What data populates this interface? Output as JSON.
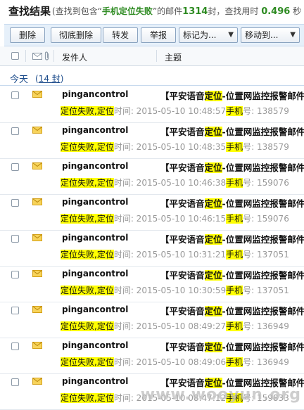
{
  "header": {
    "title": "查找结果",
    "desc_pre": "(查找到包含“",
    "keyword": "手机定位失败",
    "desc_mid": "”的邮件",
    "count": "1314",
    "desc_mid2": "封，查找用时",
    "time": "0.496",
    "desc_post": "秒"
  },
  "toolbar": {
    "delete": "删除",
    "delete_perm": "彻底删除",
    "forward": "转发",
    "report": "举报",
    "mark_as": "标记为...",
    "move_to": "移动到..."
  },
  "columns": {
    "sender": "发件人",
    "subject": "主题"
  },
  "group": {
    "label": "今天",
    "count_pre": "(",
    "count": "14 封",
    "count_post": ")"
  },
  "mails": [
    {
      "sender": "pingancontrol",
      "subj_a": "【平安语音",
      "subj_hl": "定位",
      "subj_b": "-位置网监控报警邮件",
      "pv_hl": "定位失败,定位",
      "pv_time": "时间: 2015-05-10 10:48:57",
      "pv_hl2": "手机",
      "pv_tail": "号: 138579"
    },
    {
      "sender": "pingancontrol",
      "subj_a": "【平安语音",
      "subj_hl": "定位",
      "subj_b": "-位置网监控报警邮件",
      "pv_hl": "定位失败,定位",
      "pv_time": "时间: 2015-05-10 10:48:35",
      "pv_hl2": "手机",
      "pv_tail": "号: 138579"
    },
    {
      "sender": "pingancontrol",
      "subj_a": "【平安语音",
      "subj_hl": "定位",
      "subj_b": "-位置网监控报警邮件",
      "pv_hl": "定位失败,定位",
      "pv_time": "时间: 2015-05-10 10:46:38",
      "pv_hl2": "手机",
      "pv_tail": "号: 159076"
    },
    {
      "sender": "pingancontrol",
      "subj_a": "【平安语音",
      "subj_hl": "定位",
      "subj_b": "-位置网监控报警邮件",
      "pv_hl": "定位失败,定位",
      "pv_time": "时间: 2015-05-10 10:46:15",
      "pv_hl2": "手机",
      "pv_tail": "号: 159076"
    },
    {
      "sender": "pingancontrol",
      "subj_a": "【平安语音",
      "subj_hl": "定位",
      "subj_b": "-位置网监控报警邮件",
      "pv_hl": "定位失败,定位",
      "pv_time": "时间: 2015-05-10 10:31:21",
      "pv_hl2": "手机",
      "pv_tail": "号: 137051"
    },
    {
      "sender": "pingancontrol",
      "subj_a": "【平安语音",
      "subj_hl": "定位",
      "subj_b": "-位置网监控报警邮件",
      "pv_hl": "定位失败,定位",
      "pv_time": "时间: 2015-05-10 10:30:59",
      "pv_hl2": "手机",
      "pv_tail": "号: 137051"
    },
    {
      "sender": "pingancontrol",
      "subj_a": "【平安语音",
      "subj_hl": "定位",
      "subj_b": "-位置网监控报警邮件",
      "pv_hl": "定位失败,定位",
      "pv_time": "时间: 2015-05-10 08:49:27",
      "pv_hl2": "手机",
      "pv_tail": "号: 136949"
    },
    {
      "sender": "pingancontrol",
      "subj_a": "【平安语音",
      "subj_hl": "定位",
      "subj_b": "-位置网监控报警邮件",
      "pv_hl": "定位失败,定位",
      "pv_time": "时间: 2015-05-10 08:49:06",
      "pv_hl2": "手机",
      "pv_tail": "号: 136949"
    },
    {
      "sender": "pingancontrol",
      "subj_a": "【平安语音",
      "subj_hl": "定位",
      "subj_b": "-位置网监控报警邮件",
      "pv_hl": "定位失败,定位",
      "pv_time": "时间: 2015-05-10 08:47:12",
      "pv_hl2": "手机",
      "pv_tail": "号: 159833"
    }
  ],
  "watermark": "www.wooyun.org",
  "icons": {
    "checkbox": "checkbox-icon",
    "envelope": "envelope-icon",
    "paperclip": "paperclip-icon",
    "dropdown": "chevron-down-icon"
  },
  "colors": {
    "accent_green": "#2e8b22",
    "highlight": "#ffff00",
    "toolbar_bg": "#e6f0fa",
    "envelope": "#f2c12e",
    "link_blue": "#1a4a8a"
  }
}
